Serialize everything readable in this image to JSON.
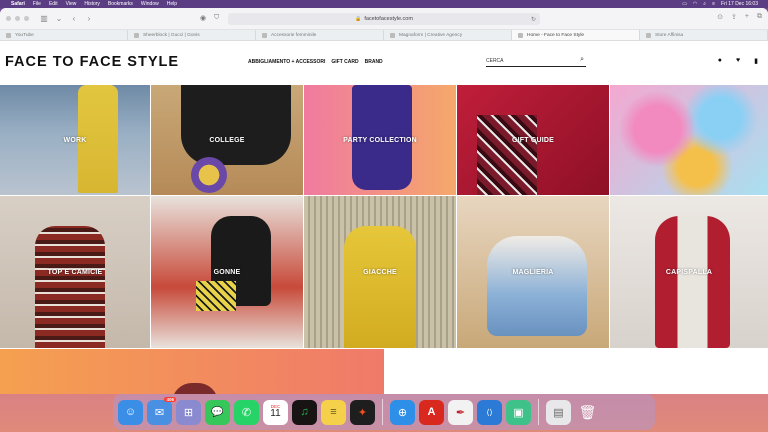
{
  "menubar": {
    "items": [
      "Safari",
      "File",
      "Edit",
      "View",
      "History",
      "Bookmarks",
      "Window",
      "Help"
    ],
    "datetime": "Fri 17 Dec 16:03"
  },
  "browser": {
    "url": "facetofacestyle.com",
    "tabs": [
      {
        "label": "YouTube",
        "active": false
      },
      {
        "label": "Sheerblock | Gucci | Gonis",
        "active": false
      },
      {
        "label": "Accessorie femminile",
        "active": false
      },
      {
        "label": "Magnaform | Creative Agency",
        "active": false
      },
      {
        "label": "Home - Face to Face Style",
        "active": true
      },
      {
        "label": "Store Affinisa",
        "active": false
      }
    ]
  },
  "site": {
    "logo": "FACE TO FACE STYLE",
    "nav": [
      "ABBIGLIAMENTO + ACCESSORI",
      "GIFT CARD",
      "BRAND"
    ],
    "search_placeholder": "CERCA"
  },
  "tiles": [
    {
      "label": "WORK"
    },
    {
      "label": "COLLEGE"
    },
    {
      "label": "PARTY COLLECTION"
    },
    {
      "label": "GIFT GUIDE"
    },
    {
      "label": ""
    },
    {
      "label": "TOP E CAMICIE"
    },
    {
      "label": "GONNE"
    },
    {
      "label": "GIACCHE"
    },
    {
      "label": "MAGLIERIA"
    },
    {
      "label": "CAPISPALLA"
    }
  ],
  "dock": {
    "apps": [
      {
        "name": "Finder",
        "icon": "finder-icon",
        "color": "#3a8ee6",
        "glyph": "☺"
      },
      {
        "name": "Mail",
        "icon": "mail-icon",
        "color": "#4a90e2",
        "glyph": "✉",
        "badge": "406"
      },
      {
        "name": "Launchpad",
        "icon": "launchpad-icon",
        "color": "#8a8ad0",
        "glyph": "⊞"
      },
      {
        "name": "Messages",
        "icon": "messages-icon",
        "color": "#35c759",
        "glyph": "💬"
      },
      {
        "name": "WhatsApp",
        "icon": "whatsapp-icon",
        "color": "#25d366",
        "glyph": "✆"
      },
      {
        "name": "Calendar",
        "icon": "calendar-icon",
        "color": "#ffffff",
        "glyph": "11",
        "month": "DEC"
      },
      {
        "name": "Spotify",
        "icon": "spotify-icon",
        "color": "#191414",
        "glyph": "♫"
      },
      {
        "name": "Notes",
        "icon": "notes-icon",
        "color": "#f5d04a",
        "glyph": "≡"
      },
      {
        "name": "Figma",
        "icon": "figma-icon",
        "color": "#1e1e1e",
        "glyph": "✦"
      },
      {
        "name": "Safari",
        "icon": "safari-icon",
        "color": "#2d8fe8",
        "glyph": "⊕"
      },
      {
        "name": "Acrobat",
        "icon": "acrobat-icon",
        "color": "#d9281e",
        "glyph": "A"
      },
      {
        "name": "Scrivener",
        "icon": "scrivener-icon",
        "color": "#f2f2f2",
        "glyph": "✒"
      },
      {
        "name": "VS Code",
        "icon": "vscode-icon",
        "color": "#2a7ad6",
        "glyph": "⟨⟩"
      },
      {
        "name": "Stats",
        "icon": "stats-icon",
        "color": "#3ec28a",
        "glyph": "▣"
      },
      {
        "name": "Preview",
        "icon": "preview-icon",
        "color": "#e8e8ea",
        "glyph": "▤"
      },
      {
        "name": "Trash",
        "icon": "trash-icon",
        "color": "#d0d4da",
        "glyph": "🗑"
      }
    ]
  }
}
